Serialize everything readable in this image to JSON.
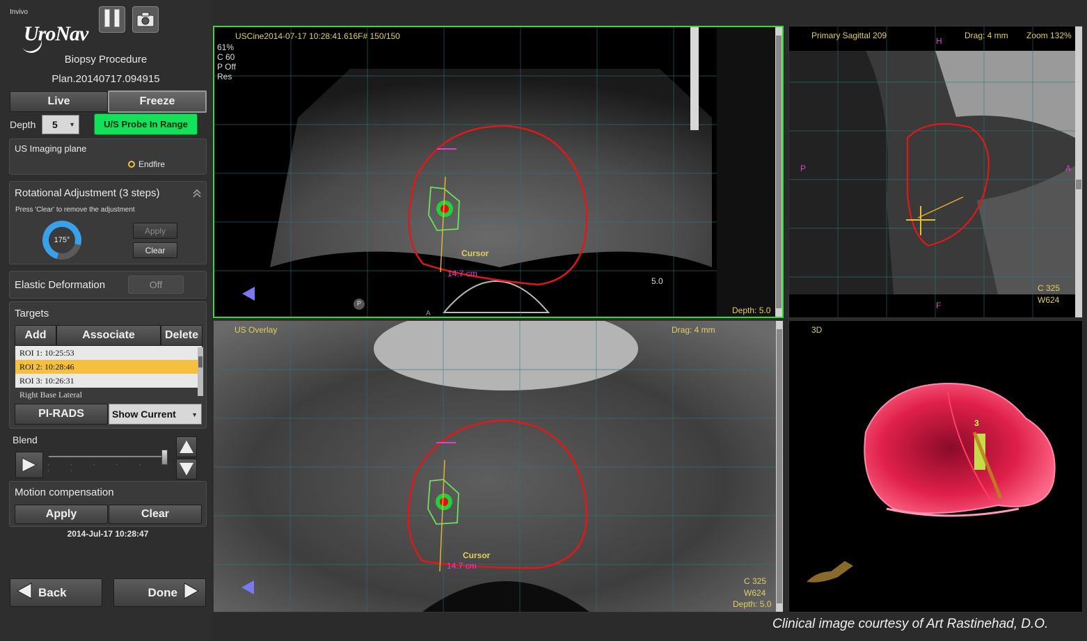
{
  "header": {
    "maker": "Invivo",
    "product": "UroNav",
    "procedure": "Biopsy Procedure",
    "plan": "Plan.20140717.094915"
  },
  "icons": [
    "pause-icon",
    "camera-icon",
    "play-icon",
    "arrow-up-icon",
    "arrow-down-icon",
    "back-arrow-icon",
    "forward-arrow-icon"
  ],
  "controls": {
    "live": "Live",
    "freeze": "Freeze",
    "depth_label": "Depth",
    "depth_value": "5",
    "probe_status": "U/S Probe In Range",
    "imaging_plane_title": "US Imaging plane",
    "imaging_plane_option": "Endfire",
    "rot_title": "Rotational Adjustment (3 steps)",
    "rot_hint": "Press 'Clear' to remove the adjustment",
    "rot_angle": "175°",
    "rot_apply": "Apply",
    "rot_clear": "Clear",
    "elastic_title": "Elastic Deformation",
    "elastic_toggle": "Off",
    "targets_title": "Targets",
    "add": "Add",
    "associate": "Associate",
    "delete": "Delete",
    "targets": [
      "ROI 1: 10:25:53",
      "ROI 2: 10:28:46",
      "ROI 3: 10:26:31",
      "Right Base Lateral"
    ],
    "selected_target_index": 1,
    "pirads": "PI-RADS",
    "show_current": "Show Current",
    "blend_label": "Blend",
    "blend_level": 0.98,
    "motion_title": "Motion compensation",
    "motion_apply": "Apply",
    "motion_clear": "Clear",
    "timestamp": "2014-Jul-17 10:28:47",
    "back": "Back",
    "done": "Done"
  },
  "viewports": {
    "us": {
      "header": "USCine2014-07-17 10:28:41.616F# 150/150",
      "params": [
        "61%",
        "C 60",
        "P Off",
        "Res"
      ],
      "depth": "Depth: 5.0",
      "depth_scale": "5.0",
      "cursor": "Cursor",
      "distance": "14.7 cm",
      "marker_a": "A",
      "marker_p": "P"
    },
    "sagittal": {
      "title": "Primary Sagittal 209",
      "drag": "Drag: 4 mm",
      "zoom": "Zoom 132%",
      "h": "H",
      "f": "F",
      "p": "P",
      "a": "A",
      "c": "C 325",
      "w": "W624"
    },
    "overlay": {
      "title": "US Overlay",
      "drag": "Drag: 4 mm",
      "cursor": "Cursor",
      "distance": "14.7 cm",
      "c": "C 325",
      "w": "W624",
      "depth": "Depth: 5.0"
    },
    "three_d": {
      "title": "3D",
      "target_label": "3"
    }
  },
  "colors": {
    "accent_green": "#14e05a",
    "selection": "#f5c040",
    "contour": "#e01818",
    "annotation": "#e0d060"
  },
  "credit": "Clinical image courtesy of Art Rastinehad, D.O."
}
